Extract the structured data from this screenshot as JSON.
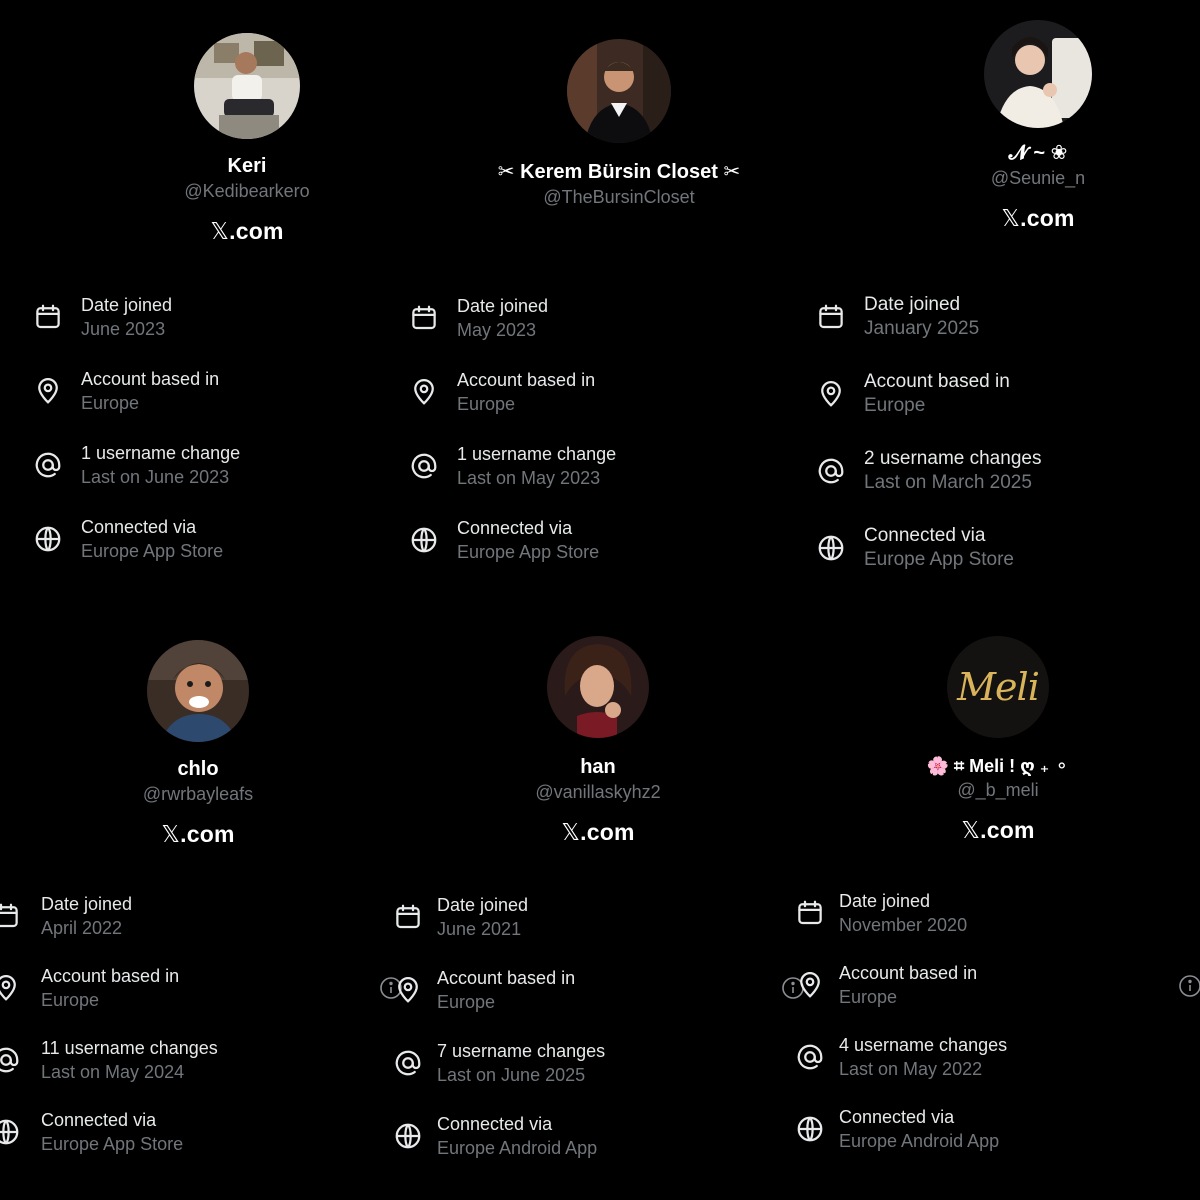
{
  "profiles": [
    {
      "display_name": "Keri",
      "handle": "@Kedibearkero",
      "site": ".com",
      "site_mark": "𝕏",
      "avatar_icon": "avatar-photo",
      "info": [
        {
          "icon": "calendar-icon",
          "label": "Date joined",
          "value": "June 2023"
        },
        {
          "icon": "location-pin-icon",
          "label": "Account based in",
          "value": "Europe"
        },
        {
          "icon": "at-sign-icon",
          "label": "1 username change",
          "value": "Last on June 2023"
        },
        {
          "icon": "globe-icon",
          "label": "Connected via",
          "value": "Europe App Store"
        }
      ]
    },
    {
      "display_name": "✂ Kerem Bürsin Closet ✂",
      "handle": "@TheBursinCloset",
      "site": "",
      "site_mark": "",
      "avatar_icon": "avatar-photo",
      "info": [
        {
          "icon": "calendar-icon",
          "label": "Date joined",
          "value": "May 2023"
        },
        {
          "icon": "location-pin-icon",
          "label": "Account based in",
          "value": "Europe"
        },
        {
          "icon": "at-sign-icon",
          "label": "1 username change",
          "value": "Last on May 2023"
        },
        {
          "icon": "globe-icon",
          "label": "Connected via",
          "value": "Europe App Store"
        }
      ]
    },
    {
      "display_name": "𝓝 ~ ❀",
      "handle": "@Seunie_n",
      "site": ".com",
      "site_mark": "𝕏",
      "avatar_icon": "avatar-photo",
      "info": [
        {
          "icon": "calendar-icon",
          "label": "Date joined",
          "value": "January 2025"
        },
        {
          "icon": "location-pin-icon",
          "label": "Account based in",
          "value": "Europe"
        },
        {
          "icon": "at-sign-icon",
          "label": "2 username changes",
          "value": "Last on March 2025"
        },
        {
          "icon": "globe-icon",
          "label": "Connected via",
          "value": "Europe App Store"
        }
      ]
    },
    {
      "display_name": "chlo",
      "handle": "@rwrbayleafs",
      "site": ".com",
      "site_mark": "𝕏",
      "avatar_icon": "avatar-photo",
      "info": [
        {
          "icon": "calendar-icon",
          "label": "Date joined",
          "value": "April 2022"
        },
        {
          "icon": "location-pin-icon",
          "label": "Account based in",
          "value": "Europe"
        },
        {
          "icon": "at-sign-icon",
          "label": "11 username changes",
          "value": "Last on May 2024"
        },
        {
          "icon": "globe-icon",
          "label": "Connected via",
          "value": "Europe App Store"
        }
      ]
    },
    {
      "display_name": "han",
      "handle": "@vanillaskyhz2",
      "site": ".com",
      "site_mark": "𝕏",
      "avatar_icon": "avatar-photo",
      "info": [
        {
          "icon": "calendar-icon",
          "label": "Date joined",
          "value": "June 2021"
        },
        {
          "icon": "location-pin-icon",
          "label": "Account based in",
          "value": "Europe"
        },
        {
          "icon": "at-sign-icon",
          "label": "7 username changes",
          "value": "Last on June 2025"
        },
        {
          "icon": "globe-icon",
          "label": "Connected via",
          "value": "Europe Android App"
        }
      ]
    },
    {
      "display_name": "🌸 ⌗ Meli ! ღ ₊ ⚬",
      "handle": "@_b_meli",
      "site": ".com",
      "site_mark": "𝕏",
      "avatar_text": "Meli",
      "avatar_icon": "avatar-logo",
      "info": [
        {
          "icon": "calendar-icon",
          "label": "Date joined",
          "value": "November 2020"
        },
        {
          "icon": "location-pin-icon",
          "label": "Account based in",
          "value": "Europe"
        },
        {
          "icon": "at-sign-icon",
          "label": "4 username changes",
          "value": "Last on May 2022"
        },
        {
          "icon": "globe-icon",
          "label": "Connected via",
          "value": "Europe Android App"
        }
      ]
    }
  ],
  "colors": {
    "background": "#000000",
    "primary_text": "#e7e9ea",
    "secondary_text": "#71767b",
    "meli_gold": "#d9b45a"
  }
}
